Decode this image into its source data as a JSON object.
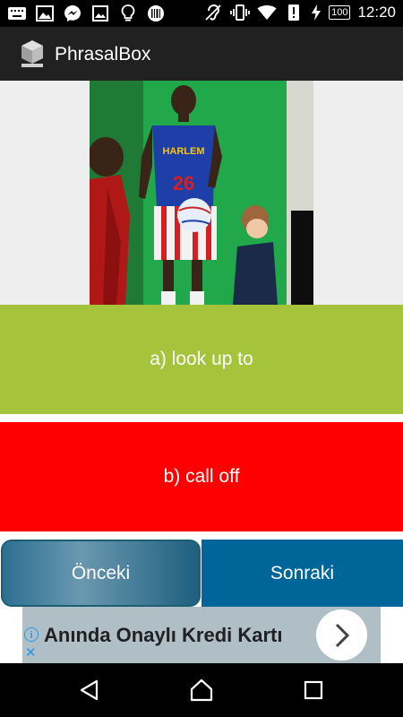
{
  "status_bar": {
    "time": "12:20",
    "battery": "100",
    "left_icons": [
      "keyboard-icon",
      "image-icon",
      "messenger-icon",
      "gallery-icon",
      "bulb-icon",
      "barcode-icon"
    ],
    "right_icons": [
      "hearing-icon",
      "vibrate-icon",
      "wifi-icon",
      "alert-icon",
      "charging-icon"
    ]
  },
  "app_bar": {
    "title": "PhrasalBox"
  },
  "quiz": {
    "photo_jersey_text": "HARLEM",
    "photo_jersey_number": "26",
    "answers": [
      {
        "label": "a) look up to",
        "color": "#a5c43b"
      },
      {
        "label": "b) call off",
        "color": "#ff0000"
      }
    ],
    "prev_label": "Önceki",
    "next_label": "Sonraki"
  },
  "ad": {
    "text": "Anında Onaylı Kredi Kartı",
    "info_icon": "info-icon",
    "close_icon": "close-icon"
  },
  "navigation": {
    "icons": [
      "back-icon",
      "home-icon",
      "recents-icon"
    ]
  }
}
